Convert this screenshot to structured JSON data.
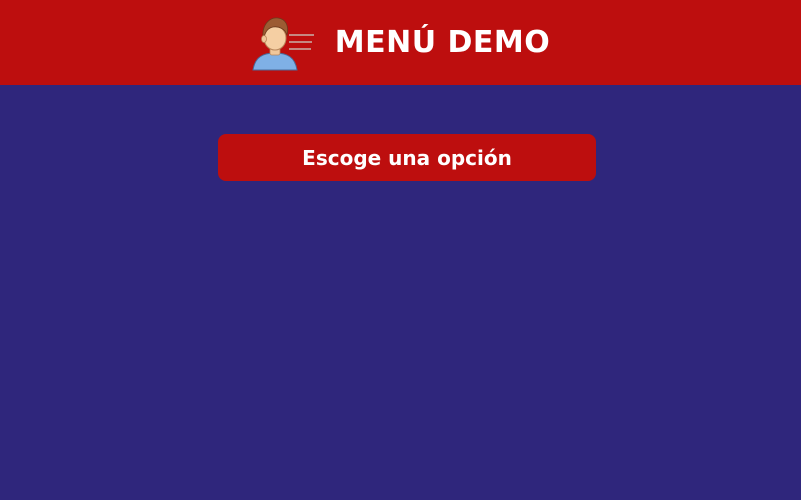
{
  "header": {
    "logo_icon": "user-avatar-icon",
    "title": "MENÚ DEMO"
  },
  "main": {
    "option_button_label": "Escoge una opción"
  },
  "colors": {
    "header_background": "#bd0e0e",
    "page_background": "#2f267c",
    "button_background": "#bd0e0e",
    "text": "#ffffff"
  }
}
